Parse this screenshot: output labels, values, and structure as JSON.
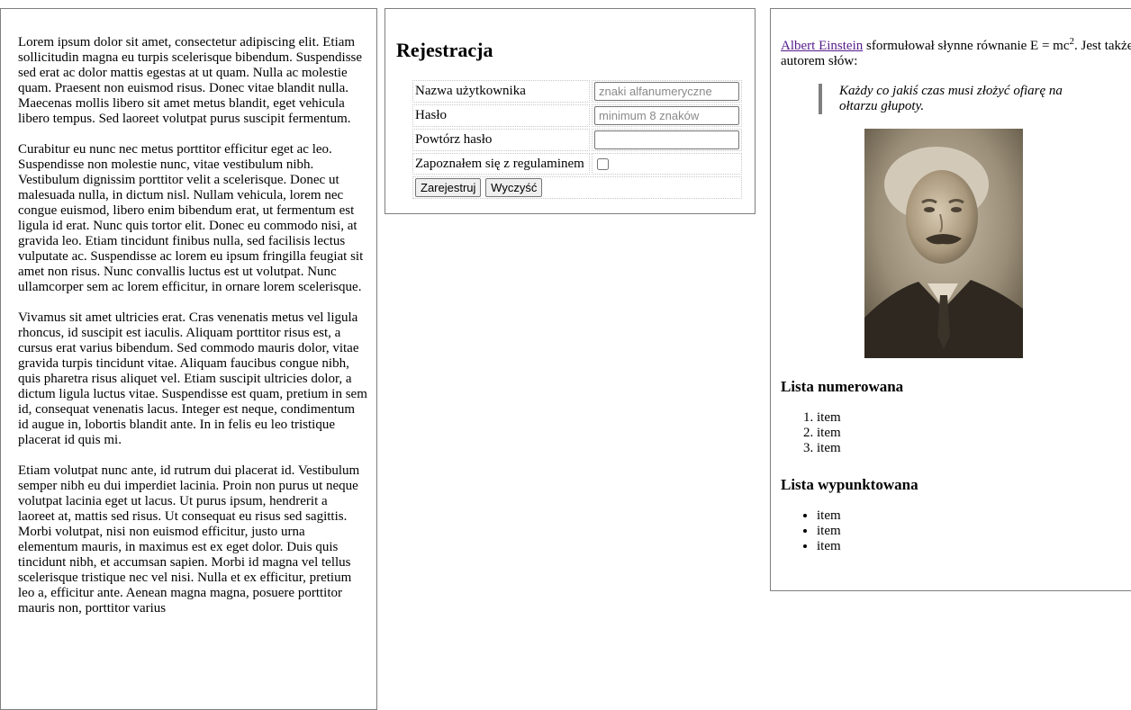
{
  "left_column": {
    "paragraphs": [
      "Lorem ipsum dolor sit amet, consectetur adipiscing elit. Etiam sollicitudin magna eu turpis scelerisque bibendum. Suspendisse sed erat ac dolor mattis egestas at ut quam. Nulla ac molestie quam. Praesent non euismod risus. Donec vitae blandit nulla. Maecenas mollis libero sit amet metus blandit, eget vehicula libero tempus. Sed laoreet volutpat purus suscipit fermentum.",
      "Curabitur eu nunc nec metus porttitor efficitur eget ac leo. Suspendisse non molestie nunc, vitae vestibulum nibh. Vestibulum dignissim porttitor velit a scelerisque. Donec ut malesuada nulla, in dictum nisl. Nullam vehicula, lorem nec congue euismod, libero enim bibendum erat, ut fermentum est ligula id erat. Nunc quis tortor elit. Donec eu commodo nisi, at gravida leo. Etiam tincidunt finibus nulla, sed facilisis lectus vulputate ac. Suspendisse ac lorem eu ipsum fringilla feugiat sit amet non risus. Nunc convallis luctus est ut volutpat. Nunc ullamcorper sem ac lorem efficitur, in ornare lorem scelerisque.",
      "Vivamus sit amet ultricies erat. Cras venenatis metus vel ligula rhoncus, id suscipit est iaculis. Aliquam porttitor risus est, a cursus erat varius bibendum. Sed commodo mauris dolor, vitae gravida turpis tincidunt vitae. Aliquam faucibus congue nibh, quis pharetra risus aliquet vel. Etiam suscipit ultricies dolor, a dictum ligula luctus vitae. Suspendisse est quam, pretium in sem id, consequat venenatis lacus. Integer est neque, condimentum id augue in, lobortis blandit ante. In in felis eu leo tristique placerat id quis mi.",
      "Etiam volutpat nunc ante, id rutrum dui placerat id. Vestibulum semper nibh eu dui imperdiet lacinia. Proin non purus ut neque volutpat lacinia eget ut lacus. Ut purus ipsum, hendrerit a laoreet at, mattis sed risus. Ut consequat eu risus sed sagittis. Morbi volutpat, nisi non euismod efficitur, justo urna elementum mauris, in maximus est ex eget dolor. Duis quis tincidunt nibh, et accumsan sapien. Morbi id magna vel tellus scelerisque tristique nec vel nisi. Nulla et ex efficitur, pretium leo a, efficitur ante. Aenean magna magna, posuere porttitor mauris non, porttitor varius"
    ]
  },
  "registration": {
    "title": "Rejestracja",
    "username_label": "Nazwa użytkownika",
    "username_placeholder": "znaki alfanumeryczne",
    "password_label": "Hasło",
    "password_placeholder": "minimum 8 znaków",
    "repeat_password_label": "Powtórz hasło",
    "terms_label": "Zapoznałem się z regulaminem",
    "submit_label": "Zarejestruj",
    "reset_label": "Wyczyść"
  },
  "right_column": {
    "intro_link": "Albert Einstein",
    "intro_text_1": " sformułował słynne równanie E = mc",
    "intro_superscript": "2",
    "intro_text_2": ". Jest także autorem słów:",
    "quote": "Każdy co jakiś czas musi złożyć ofiarę na ołtarzu głupoty.",
    "ordered_heading": "Lista numerowana",
    "ordered_items": [
      "item",
      "item",
      "item"
    ],
    "bullet_heading": "Lista wypunktowana",
    "bullet_items": [
      "item",
      "item",
      "item"
    ]
  }
}
